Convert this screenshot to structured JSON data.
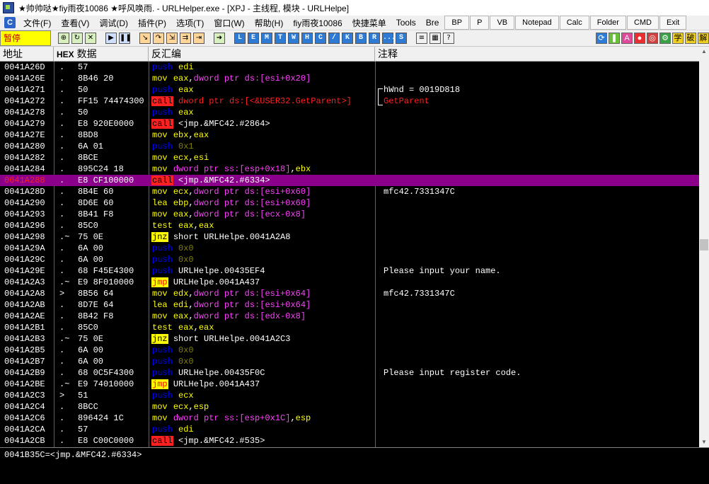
{
  "window": {
    "title": "★帅帅哒★fiy雨夜10086  ★呼风唤雨. - URLHelper.exe - [XPJ - 主线程, 模块 - URLHelpe]"
  },
  "menu": {
    "items": [
      "文件(F)",
      "查看(V)",
      "调试(D)",
      "插件(P)",
      "选项(T)",
      "窗口(W)",
      "帮助(H)",
      "fiy雨夜10086",
      "快捷菜单",
      "Tools",
      "Bre"
    ],
    "tool_buttons": [
      "BP",
      "P",
      "VB",
      "Notepad",
      "Calc",
      "Folder",
      "CMD",
      "Exit"
    ]
  },
  "toolbar": {
    "status": "暂停",
    "letter_buttons": [
      "L",
      "E",
      "M",
      "T",
      "W",
      "H",
      "C",
      "/",
      "K",
      "B",
      "R",
      "...",
      "S"
    ],
    "right_labels": [
      "学",
      "破",
      "解"
    ]
  },
  "columns": {
    "address": "地址",
    "hex_tag": "HEX",
    "hex": "数据",
    "disasm": "反汇编",
    "comment": "注释"
  },
  "rows": [
    {
      "addr": "0041A26D",
      "mark": ".",
      "hex": "57",
      "mn": "push",
      "mcls": "push",
      "ops": [
        [
          "edi",
          "reg"
        ]
      ],
      "com": ""
    },
    {
      "addr": "0041A26E",
      "mark": ".",
      "hex": "8B46 20",
      "mn": "mov",
      "mcls": "mov",
      "ops": [
        [
          "eax",
          "reg"
        ],
        [
          ",",
          ""
        ],
        [
          "dword ptr ds:[esi+0x20]",
          "mem"
        ]
      ],
      "com": ""
    },
    {
      "addr": "0041A271",
      "mark": ".",
      "hex": "50",
      "mn": "push",
      "mcls": "push",
      "ops": [
        [
          "eax",
          "reg"
        ]
      ],
      "com": "hWnd = 0019D818"
    },
    {
      "addr": "0041A272",
      "mark": ".",
      "hex": "FF15 74474300",
      "mn": "call",
      "mcls": "call",
      "ops": [
        [
          "dword ptr ds:[<&USER32.GetParent>]",
          "red"
        ]
      ],
      "com": "GetParent",
      "comcls": "red"
    },
    {
      "addr": "0041A278",
      "mark": ".",
      "hex": "50",
      "mn": "push",
      "mcls": "push",
      "ops": [
        [
          "eax",
          "reg"
        ]
      ],
      "com": ""
    },
    {
      "addr": "0041A279",
      "mark": ".",
      "hex": "E8 920E0000",
      "mn": "call",
      "mcls": "call",
      "ops": [
        [
          "<jmp.&MFC42.#2864>",
          ""
        ]
      ],
      "com": ""
    },
    {
      "addr": "0041A27E",
      "mark": ".",
      "hex": "8BD8",
      "mn": "mov",
      "mcls": "mov",
      "ops": [
        [
          "ebx",
          "reg"
        ],
        [
          ",",
          ""
        ],
        [
          "eax",
          "reg"
        ]
      ],
      "com": ""
    },
    {
      "addr": "0041A280",
      "mark": ".",
      "hex": "6A 01",
      "mn": "push",
      "mcls": "push",
      "ops": [
        [
          "0x1",
          "imm"
        ]
      ],
      "com": ""
    },
    {
      "addr": "0041A282",
      "mark": ".",
      "hex": "8BCE",
      "mn": "mov",
      "mcls": "mov",
      "ops": [
        [
          "ecx",
          "reg"
        ],
        [
          ",",
          ""
        ],
        [
          "esi",
          "reg"
        ]
      ],
      "com": ""
    },
    {
      "addr": "0041A284",
      "mark": ".",
      "hex": "895C24 18",
      "mn": "mov",
      "mcls": "mov",
      "ops": [
        [
          "dword ptr ss:[esp+0x18]",
          "mem"
        ],
        [
          ",",
          ""
        ],
        [
          "ebx",
          "reg"
        ]
      ],
      "com": ""
    },
    {
      "addr": "0041A288",
      "mark": ".",
      "hex": "E8 CF100000",
      "mn": "call",
      "mcls": "call",
      "ops": [
        [
          "<jmp.&MFC42.#6334>",
          ""
        ]
      ],
      "com": "",
      "selected": true
    },
    {
      "addr": "0041A28D",
      "mark": ".",
      "hex": "8B4E 60",
      "mn": "mov",
      "mcls": "mov",
      "ops": [
        [
          "ecx",
          "reg"
        ],
        [
          ",",
          ""
        ],
        [
          "dword ptr ds:[esi+0x60]",
          "mem"
        ]
      ],
      "com": "mfc42.7331347C"
    },
    {
      "addr": "0041A290",
      "mark": ".",
      "hex": "8D6E 60",
      "mn": "lea",
      "mcls": "mov",
      "ops": [
        [
          "ebp",
          "reg"
        ],
        [
          ",",
          ""
        ],
        [
          "dword ptr ds:[esi+0x60]",
          "mem"
        ]
      ],
      "com": ""
    },
    {
      "addr": "0041A293",
      "mark": ".",
      "hex": "8B41 F8",
      "mn": "mov",
      "mcls": "mov",
      "ops": [
        [
          "eax",
          "reg"
        ],
        [
          ",",
          ""
        ],
        [
          "dword ptr ds:[ecx-0x8]",
          "mem"
        ]
      ],
      "com": ""
    },
    {
      "addr": "0041A296",
      "mark": ".",
      "hex": "85C0",
      "mn": "test",
      "mcls": "mov",
      "ops": [
        [
          "eax",
          "reg"
        ],
        [
          ",",
          ""
        ],
        [
          "eax",
          "reg"
        ]
      ],
      "com": ""
    },
    {
      "addr": "0041A298",
      "mark": ".~",
      "hex": "75 0E",
      "mn": "jnz",
      "mcls": "jcc",
      "ops": [
        [
          "short URLHelpe.0041A2A8",
          ""
        ]
      ],
      "com": ""
    },
    {
      "addr": "0041A29A",
      "mark": ".",
      "hex": "6A 00",
      "mn": "push",
      "mcls": "push",
      "ops": [
        [
          "0x0",
          "imm"
        ]
      ],
      "com": ""
    },
    {
      "addr": "0041A29C",
      "mark": ".",
      "hex": "6A 00",
      "mn": "push",
      "mcls": "push",
      "ops": [
        [
          "0x0",
          "imm"
        ]
      ],
      "com": ""
    },
    {
      "addr": "0041A29E",
      "mark": ".",
      "hex": "68 F45E4300",
      "mn": "push",
      "mcls": "push",
      "ops": [
        [
          "URLHelpe.00435EF4",
          ""
        ]
      ],
      "com": "Please input your name."
    },
    {
      "addr": "0041A2A3",
      "mark": ".~",
      "hex": "E9 8F010000",
      "mn": "jmp",
      "mcls": "jmp",
      "ops": [
        [
          "URLHelpe.0041A437",
          ""
        ]
      ],
      "com": ""
    },
    {
      "addr": "0041A2A8",
      "mark": ">",
      "hex": "8B56 64",
      "mn": "mov",
      "mcls": "mov",
      "ops": [
        [
          "edx",
          "reg"
        ],
        [
          ",",
          ""
        ],
        [
          "dword ptr ds:[esi+0x64]",
          "mem"
        ]
      ],
      "com": "mfc42.7331347C"
    },
    {
      "addr": "0041A2AB",
      "mark": ".",
      "hex": "8D7E 64",
      "mn": "lea",
      "mcls": "mov",
      "ops": [
        [
          "edi",
          "reg"
        ],
        [
          ",",
          ""
        ],
        [
          "dword ptr ds:[esi+0x64]",
          "mem"
        ]
      ],
      "com": ""
    },
    {
      "addr": "0041A2AE",
      "mark": ".",
      "hex": "8B42 F8",
      "mn": "mov",
      "mcls": "mov",
      "ops": [
        [
          "eax",
          "reg"
        ],
        [
          ",",
          ""
        ],
        [
          "dword ptr ds:[edx-0x8]",
          "mem"
        ]
      ],
      "com": ""
    },
    {
      "addr": "0041A2B1",
      "mark": ".",
      "hex": "85C0",
      "mn": "test",
      "mcls": "mov",
      "ops": [
        [
          "eax",
          "reg"
        ],
        [
          ",",
          ""
        ],
        [
          "eax",
          "reg"
        ]
      ],
      "com": ""
    },
    {
      "addr": "0041A2B3",
      "mark": ".~",
      "hex": "75 0E",
      "mn": "jnz",
      "mcls": "jcc",
      "ops": [
        [
          "short URLHelpe.0041A2C3",
          ""
        ]
      ],
      "com": ""
    },
    {
      "addr": "0041A2B5",
      "mark": ".",
      "hex": "6A 00",
      "mn": "push",
      "mcls": "push",
      "ops": [
        [
          "0x0",
          "imm"
        ]
      ],
      "com": ""
    },
    {
      "addr": "0041A2B7",
      "mark": ".",
      "hex": "6A 00",
      "mn": "push",
      "mcls": "push",
      "ops": [
        [
          "0x0",
          "imm"
        ]
      ],
      "com": ""
    },
    {
      "addr": "0041A2B9",
      "mark": ".",
      "hex": "68 0C5F4300",
      "mn": "push",
      "mcls": "push",
      "ops": [
        [
          "URLHelpe.00435F0C",
          ""
        ]
      ],
      "com": "Please input register code."
    },
    {
      "addr": "0041A2BE",
      "mark": ".~",
      "hex": "E9 74010000",
      "mn": "jmp",
      "mcls": "jmp",
      "ops": [
        [
          "URLHelpe.0041A437",
          ""
        ]
      ],
      "com": ""
    },
    {
      "addr": "0041A2C3",
      "mark": ">",
      "hex": "51",
      "mn": "push",
      "mcls": "push",
      "ops": [
        [
          "ecx",
          "reg"
        ]
      ],
      "com": ""
    },
    {
      "addr": "0041A2C4",
      "mark": ".",
      "hex": "8BCC",
      "mn": "mov",
      "mcls": "mov",
      "ops": [
        [
          "ecx",
          "reg"
        ],
        [
          ",",
          ""
        ],
        [
          "esp",
          "reg"
        ]
      ],
      "com": ""
    },
    {
      "addr": "0041A2C6",
      "mark": ".",
      "hex": "896424 1C",
      "mn": "mov",
      "mcls": "mov",
      "ops": [
        [
          "dword ptr ss:[esp+0x1C]",
          "mem"
        ],
        [
          ",",
          ""
        ],
        [
          "esp",
          "reg"
        ]
      ],
      "com": ""
    },
    {
      "addr": "0041A2CA",
      "mark": ".",
      "hex": "57",
      "mn": "push",
      "mcls": "push",
      "ops": [
        [
          "edi",
          "reg"
        ]
      ],
      "com": ""
    },
    {
      "addr": "0041A2CB",
      "mark": ".",
      "hex": "E8 C00C0000",
      "mn": "call",
      "mcls": "call",
      "ops": [
        [
          "<jmp.&MFC42.#535>",
          ""
        ]
      ],
      "com": ""
    }
  ],
  "info_line": "0041B35C=<jmp.&MFC42.#6334>"
}
